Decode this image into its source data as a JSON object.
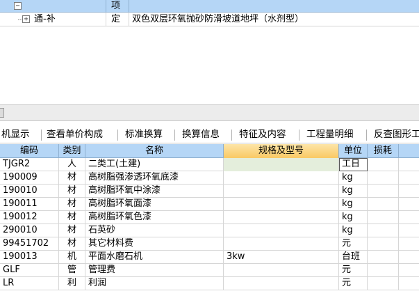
{
  "top_tree": {
    "header": {
      "toggle": "−",
      "type_label": "项"
    },
    "rows": [
      {
        "toggle": "+",
        "name": "通-补",
        "type": "定",
        "description": "双色双层环氧抛砂防滑坡道地坪（水剂型）"
      }
    ]
  },
  "tabs": [
    {
      "label": "机显示"
    },
    {
      "label": "查看单价构成"
    },
    {
      "label": "标准换算"
    },
    {
      "label": "换算信息"
    },
    {
      "label": "特征及内容"
    },
    {
      "label": "工程量明细"
    },
    {
      "label": "反查图形工"
    }
  ],
  "grid": {
    "columns": [
      "编码",
      "类别",
      "名称",
      "规格及型号",
      "单位",
      "损耗"
    ],
    "rows": [
      {
        "code": "TJGR2",
        "type": "人",
        "name": "二类工(土建)",
        "spec": "",
        "unit": "工日",
        "loss": ""
      },
      {
        "code": "190009",
        "type": "材",
        "name": "高树脂强渗透环氧底漆",
        "spec": "",
        "unit": "kg",
        "loss": ""
      },
      {
        "code": "190010",
        "type": "材",
        "name": "高树脂环氧中涂漆",
        "spec": "",
        "unit": "kg",
        "loss": ""
      },
      {
        "code": "190011",
        "type": "材",
        "name": "高树脂环氧面漆",
        "spec": "",
        "unit": "kg",
        "loss": ""
      },
      {
        "code": "190012",
        "type": "材",
        "name": "高树脂环氧色漆",
        "spec": "",
        "unit": "kg",
        "loss": ""
      },
      {
        "code": "290010",
        "type": "材",
        "name": "石英砂",
        "spec": "",
        "unit": "kg",
        "loss": ""
      },
      {
        "code": "99451702",
        "type": "材",
        "name": "其它材料费",
        "spec": "",
        "unit": "元",
        "loss": ""
      },
      {
        "code": "190013",
        "type": "机",
        "name": "平面水磨石机",
        "spec": "3kw",
        "unit": "台班",
        "loss": ""
      },
      {
        "code": "GLF",
        "type": "管",
        "name": "管理费",
        "spec": "",
        "unit": "元",
        "loss": ""
      },
      {
        "code": "LR",
        "type": "利",
        "name": "利润",
        "spec": "",
        "unit": "元",
        "loss": ""
      }
    ]
  },
  "colors": {
    "header_bg": "#b5d6f6",
    "active_header": "#f9c964",
    "active_cell": "#e4eedc",
    "gridline": "#d6d6d6"
  }
}
